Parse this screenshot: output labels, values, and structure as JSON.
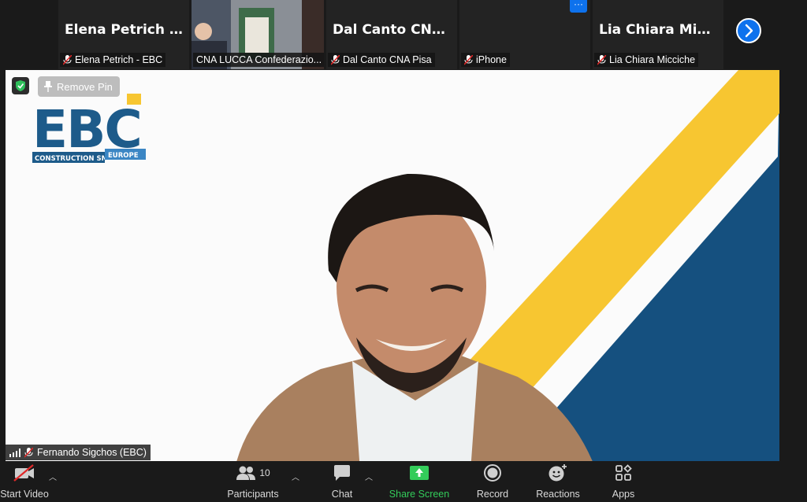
{
  "strip": {
    "tiles": [
      {
        "big_name": "Elena Petrich -...",
        "label": "Elena Petrich - EBC"
      },
      {
        "big_name": "",
        "label": "CNA LUCCA Confederazio..."
      },
      {
        "big_name": "Dal Canto CNA...",
        "label": "Dal Canto CNA Pisa"
      },
      {
        "big_name": "",
        "label": "iPhone"
      },
      {
        "big_name": "Lia Chiara Micci...",
        "label": "Lia Chiara Micciche"
      }
    ],
    "more_label": "···"
  },
  "main": {
    "remove_pin": "Remove Pin",
    "speaker_label": "Fernando Sigchos (EBC)",
    "logo": {
      "letters": "EBC",
      "sub_a": "CONSTRUCTION SMEs",
      "sub_b": "EUROPE"
    }
  },
  "toolbar": {
    "start_video": "Start Video",
    "participants": "Participants",
    "participants_count": "10",
    "chat": "Chat",
    "share_screen": "Share Screen",
    "record": "Record",
    "reactions": "Reactions",
    "apps": "Apps"
  },
  "colors": {
    "accent": "#0e72ed",
    "share": "#33cc5a",
    "active_border": "#6bbd3e",
    "logo_blue": "#1d5b8a",
    "logo_yellow": "#f7c631"
  }
}
